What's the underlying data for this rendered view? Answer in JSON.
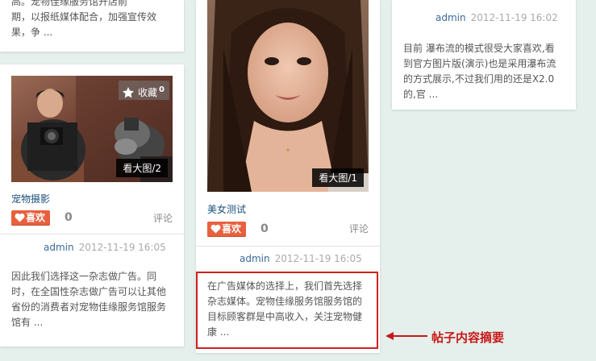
{
  "col1": {
    "top_snippet": [
      "高。宠物佳缘服务馆开店前",
      "期，以报纸媒体配合，加强宣传效",
      "果，争 ..."
    ],
    "post": {
      "favorite_label": "收藏",
      "favorite_count": "0",
      "image_caption": "看大图/2",
      "title": "宠物摄影",
      "like_label": "喜欢",
      "like_count": "0",
      "comment_label": "评论",
      "author": "admin",
      "time": "2012-11-19 16:05",
      "snippet": [
        "因此我们选择这一杂志做广告。同",
        "时，在全国性杂志做广告可以让其他",
        "省份的消费者对宠物佳缘服务馆服务",
        "馆有 ..."
      ]
    }
  },
  "col2": {
    "post": {
      "image_caption": "看大图/1",
      "title": "美女测试",
      "like_label": "喜欢",
      "like_count": "0",
      "comment_label": "评论",
      "author": "admin",
      "time": "2012-11-19 16:05",
      "snippet": [
        "在广告媒体的选择上，我们首先选择",
        "杂志媒体。宠物佳缘服务馆服务馆的",
        "目标顾客群是中高收入，关注宠物健",
        "康 ..."
      ]
    }
  },
  "col3": {
    "post": {
      "author": "admin",
      "time": "2012-11-19 16:02",
      "snippet": [
        "目前 瀑布流的模式很受大家喜欢,看",
        "到官方图片版(演示)也是采用瀑布流",
        "的方式展示,不过我们用的还是X2.0",
        "的,官 ..."
      ]
    }
  },
  "annotation": {
    "label": "帖子内容摘要",
    "color": "#c81818"
  },
  "colors": {
    "background": "#e5f0ec",
    "like_button": "#e8603e",
    "author_link": "#3a6a9a",
    "title_link": "#1c4f7a"
  }
}
